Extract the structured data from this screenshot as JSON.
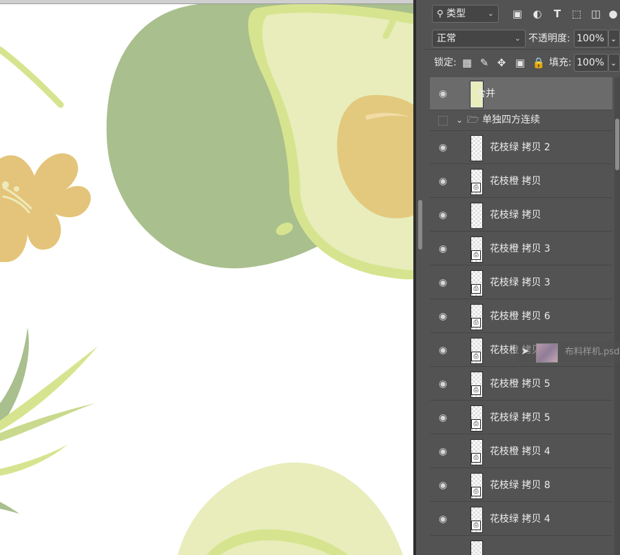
{
  "filter": {
    "kind_label": "类型"
  },
  "blend": {
    "mode": "正常",
    "opacity_label": "不透明度:",
    "opacity_value": "100%"
  },
  "lock": {
    "label": "锁定:",
    "fill_label": "填充:",
    "fill_value": "100%"
  },
  "layers": [
    {
      "name": "合并",
      "visible": true,
      "selected": true
    },
    {
      "name": "单独四方连续",
      "visible": false,
      "group": true
    },
    {
      "name": "花枝绿 拷贝 2",
      "visible": true
    },
    {
      "name": "花枝橙 拷贝",
      "visible": true
    },
    {
      "name": "花枝绿 拷贝",
      "visible": true
    },
    {
      "name": "花枝橙 拷贝 3",
      "visible": true
    },
    {
      "name": "花枝绿 拷贝 3",
      "visible": true
    },
    {
      "name": "花枝橙 拷贝 6",
      "visible": true
    },
    {
      "name": "花枝橙 拷贝 7",
      "visible": true
    },
    {
      "name": "花枝橙 拷贝 5",
      "visible": true
    },
    {
      "name": "花枝绿 拷贝 5",
      "visible": true
    },
    {
      "name": "花枝橙 拷贝 4",
      "visible": true
    },
    {
      "name": "花枝绿 拷贝 8",
      "visible": true
    },
    {
      "name": "花枝绿 拷贝 4",
      "visible": true
    }
  ],
  "drag": {
    "file_name": "布料样机.psd"
  },
  "colors": {
    "avocado_dark": "#a9bf8d",
    "avocado_light": "#e8edbb",
    "avocado_rim": "#d7e48f",
    "pit": "#e3c97e",
    "flower": "#e4c47a"
  }
}
